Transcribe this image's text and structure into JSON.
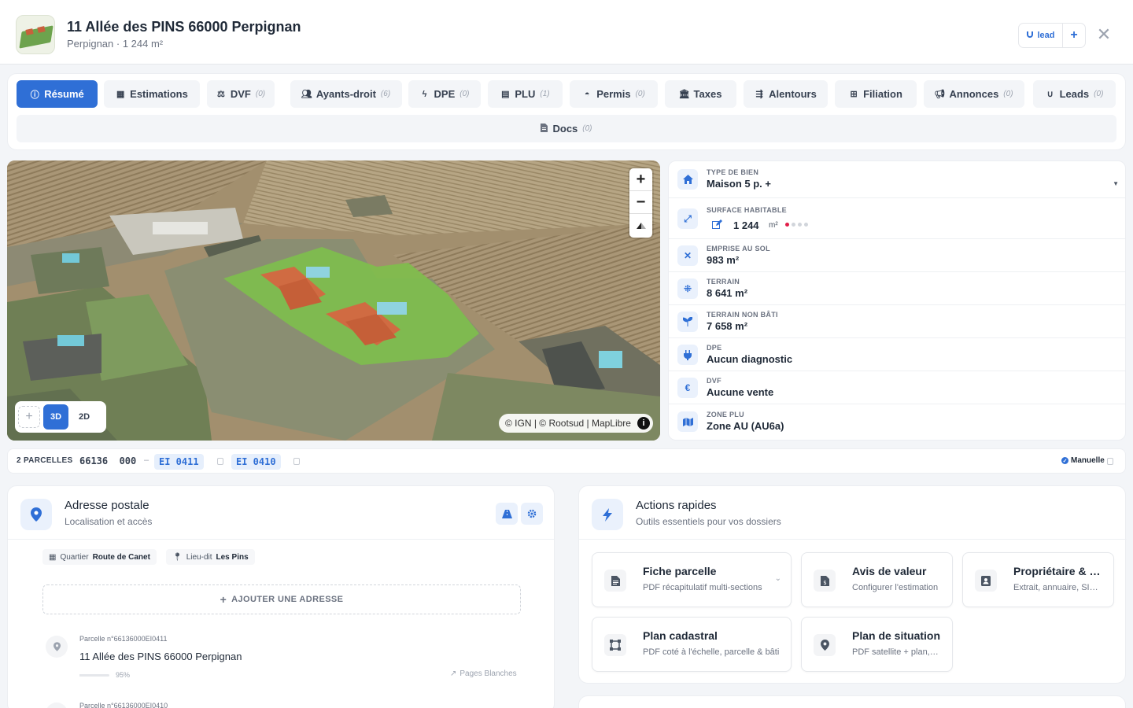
{
  "header": {
    "title": "11 Allée des PINS 66000 Perpignan",
    "subtitle": "Perpignan · 1 244 m²",
    "lead_label": "lead",
    "plus_label": "+",
    "close_label": "✕"
  },
  "tabs": [
    {
      "label": "Résumé",
      "count": "",
      "icon": "info-icon"
    },
    {
      "label": "Estimations",
      "count": "",
      "icon": "calculator-icon"
    },
    {
      "label": "DVF",
      "count": "(0)",
      "icon": "balance-icon"
    },
    {
      "label": "Ayants-droit",
      "count": "(6)",
      "icon": "users-icon"
    },
    {
      "label": "DPE",
      "count": "(0)",
      "icon": "bolt-icon"
    },
    {
      "label": "PLU",
      "count": "(1)",
      "icon": "map-icon"
    },
    {
      "label": "Permis",
      "count": "(0)",
      "icon": "helmet-icon"
    },
    {
      "label": "Taxes",
      "count": "",
      "icon": "landmark-icon"
    },
    {
      "label": "Alentours",
      "count": "",
      "icon": "signs-icon"
    },
    {
      "label": "Filiation",
      "count": "",
      "icon": "sitemap-icon"
    },
    {
      "label": "Annonces",
      "count": "(0)",
      "icon": "bullhorn-icon"
    },
    {
      "label": "Leads",
      "count": "(0)",
      "icon": "magnet-icon"
    }
  ],
  "docs_tab": {
    "label": "Docs",
    "count": "(0)"
  },
  "map": {
    "attribution": "© IGN | © Rootsud | MapLibre",
    "mode_3d": "3D",
    "mode_2d": "2D",
    "zoom_in": "+",
    "zoom_out": "−"
  },
  "property": {
    "type_label": "TYPE DE BIEN",
    "type_value": "Maison 5 p. +",
    "surface_label": "SURFACE HABITABLE",
    "surface_value": "1 244",
    "surface_unit": "m²",
    "emprise_label": "EMPRISE AU SOL",
    "emprise_value": "983 m²",
    "terrain_label": "TERRAIN",
    "terrain_value": "8 641 m²",
    "nonbati_label": "TERRAIN NON BÂTI",
    "nonbati_value": "7 658 m²",
    "dpe_label": "DPE",
    "dpe_value": "Aucun diagnostic",
    "dvf_label": "DVF",
    "dvf_value": "Aucune vente",
    "plu_label": "ZONE PLU",
    "plu_value": "Zone AU (AU6a)"
  },
  "parcels": {
    "label": "2 PARCELLES",
    "commune_code": "66136",
    "prefix": "000",
    "separator": "–",
    "items": [
      "EI  0411",
      "EI  0410"
    ],
    "mode": "Manuelle"
  },
  "address_card": {
    "title": "Adresse postale",
    "subtitle": "Localisation et accès",
    "quartier_label": "Quartier",
    "quartier_value": "Route de Canet",
    "lieudit_label": "Lieu-dit",
    "lieudit_value": "Les Pins",
    "add_label": "AJOUTER UNE ADRESSE",
    "items": [
      {
        "parcel": "Parcelle n°66136000EI0411",
        "address": "11 Allée des PINS 66000 Perpignan",
        "confidence": "95%",
        "confidence_value": 0.95,
        "source": "Pages Blanches"
      },
      {
        "parcel": "Parcelle n°66136000EI0410"
      }
    ]
  },
  "quick_actions": {
    "title": "Actions rapides",
    "subtitle": "Outils essentiels pour vos dossiers",
    "tiles": [
      {
        "title": "Fiche parcelle",
        "sub": "PDF récapitulatif multi-sections"
      },
      {
        "title": "Avis de valeur",
        "sub": "Configurer l'estimation"
      },
      {
        "title": "Propriétaire & coordonnées",
        "sub": "Extrait, annuaire, SIREN"
      },
      {
        "title": "Plan cadastral",
        "sub": "PDF coté à l'échelle, parcelle & bâti"
      },
      {
        "title": "Plan de situation",
        "sub": "PDF satellite + plan, échelles"
      }
    ]
  },
  "colors": {
    "accent": "#2f6fd6",
    "danger": "#e11d48",
    "parcel_fill": "#7cc24a"
  }
}
